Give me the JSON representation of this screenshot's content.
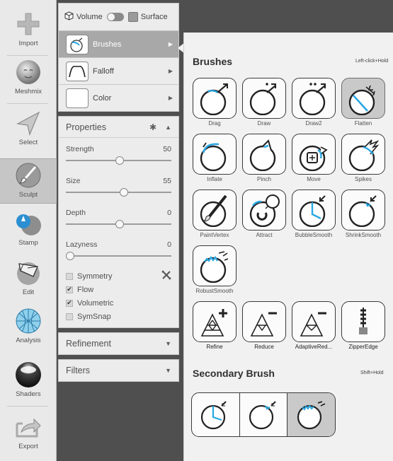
{
  "toolbar": {
    "items": [
      {
        "label": "Import",
        "icon": "plus-icon"
      },
      {
        "label": "Meshmix",
        "icon": "meshmix-face-icon"
      },
      {
        "label": "Select",
        "icon": "arrow-pointer-icon"
      },
      {
        "label": "Sculpt",
        "icon": "brush-icon"
      },
      {
        "label": "Stamp",
        "icon": "stamp-icon"
      },
      {
        "label": "Edit",
        "icon": "edit-cube-icon"
      },
      {
        "label": "Analysis",
        "icon": "analysis-sphere-icon"
      },
      {
        "label": "Shaders",
        "icon": "shader-sphere-icon"
      },
      {
        "label": "Export",
        "icon": "export-icon"
      }
    ],
    "active": "Sculpt"
  },
  "mode": {
    "volume_label": "Volume",
    "surface_label": "Surface"
  },
  "panel_menu": [
    {
      "label": "Brushes",
      "selected": true
    },
    {
      "label": "Falloff",
      "selected": false
    },
    {
      "label": "Color",
      "selected": false
    }
  ],
  "properties": {
    "title": "Properties",
    "sliders": [
      {
        "label": "Strength",
        "value": "50",
        "fraction": 0.5
      },
      {
        "label": "Size",
        "value": "55",
        "fraction": 0.55
      },
      {
        "label": "Depth",
        "value": "0",
        "fraction": 0.5
      },
      {
        "label": "Lazyness",
        "value": "0",
        "fraction": 0.0
      }
    ],
    "options": [
      {
        "label": "Symmetry",
        "checked": false
      },
      {
        "label": "Flow",
        "checked": true
      },
      {
        "label": "Volumetric",
        "checked": true
      },
      {
        "label": "SymSnap",
        "checked": false
      }
    ],
    "check_mark": "✔"
  },
  "refinement": {
    "title": "Refinement"
  },
  "filters": {
    "title": "Filters"
  },
  "brushes": {
    "title": "Brushes",
    "hint": "Left-click+Hold",
    "items": [
      "Drag",
      "Draw",
      "Draw2",
      "Flatten",
      "Inflate",
      "Pinch",
      "Move",
      "Spikes",
      "PaintVertex",
      "Attract",
      "BubbleSmooth",
      "ShrinkSmooth",
      "RobustSmooth"
    ],
    "active": "Flatten",
    "refine_items": [
      "Refine",
      "Reduce",
      "AdaptiveRed...",
      "ZipperEdge"
    ],
    "secondary_title": "Secondary Brush",
    "secondary_hint": "Shift+Hold"
  },
  "colors": {
    "accent_blue": "#2aa7e1",
    "panel_bg": "#ececec",
    "selected_row": "#a8a8a8"
  }
}
